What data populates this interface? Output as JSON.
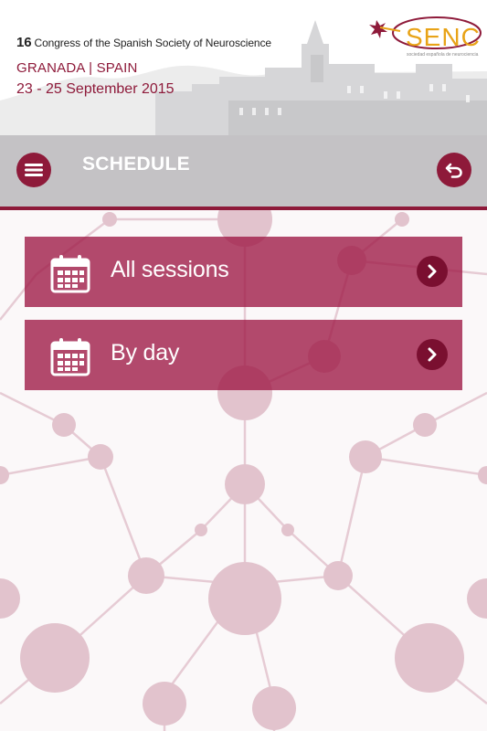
{
  "header": {
    "congress_number": "16",
    "congress_text": "Congress of the Spanish Society of Neuroscience",
    "location": "GRANADA | SPAIN",
    "dates": "23 - 25 September 2015",
    "logo_text": "SENC",
    "logo_subtitle": "sociedad española de neurociencia"
  },
  "titlebar": {
    "title": "SCHEDULE",
    "menu_icon": "hamburger-icon",
    "back_icon": "back-arrow-icon"
  },
  "menu": {
    "items": [
      {
        "label": "All sessions",
        "icon": "calendar-icon",
        "action_icon": "chevron-right-icon"
      },
      {
        "label": "By day",
        "icon": "calendar-icon",
        "action_icon": "chevron-right-icon"
      }
    ]
  },
  "colors": {
    "brand": "#8e1a3a",
    "row_bg": "#a3204b",
    "titlebar_bg": "#c4c2c5",
    "network": "#e2c3cd"
  }
}
